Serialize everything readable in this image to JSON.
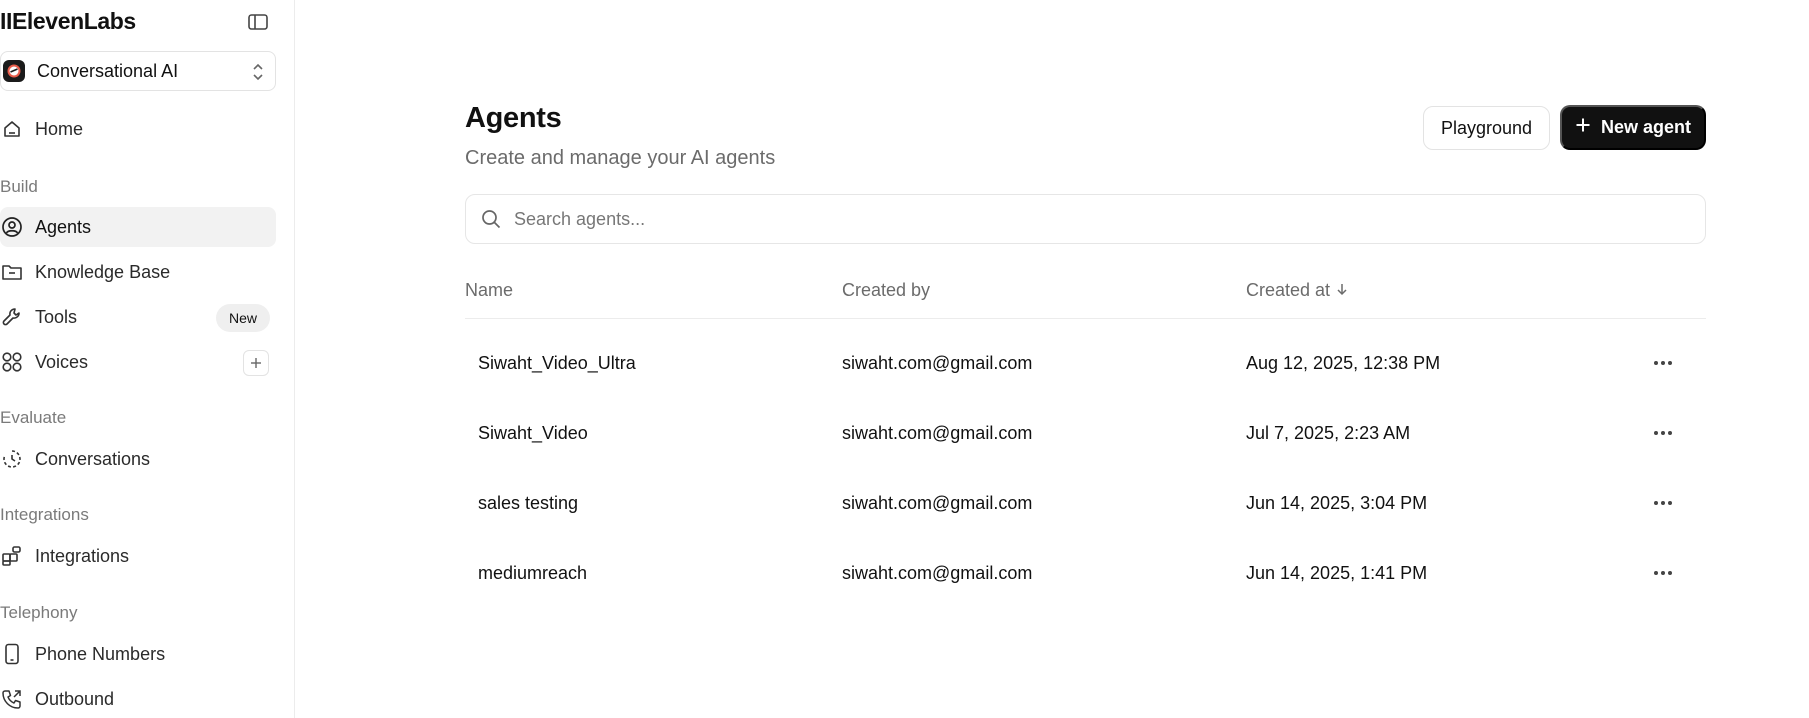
{
  "app": {
    "logo": "IIElevenLabs"
  },
  "workspace": {
    "label": "Conversational AI"
  },
  "sidebar": {
    "home": "Home",
    "sections": {
      "build": "Build",
      "evaluate": "Evaluate",
      "integrations": "Integrations",
      "telephony": "Telephony"
    },
    "items": {
      "agents": "Agents",
      "knowledge_base": "Knowledge Base",
      "tools": "Tools",
      "tools_badge": "New",
      "voices": "Voices",
      "conversations": "Conversations",
      "integrations": "Integrations",
      "phone_numbers": "Phone Numbers",
      "outbound": "Outbound"
    }
  },
  "header": {
    "title": "Agents",
    "subtitle": "Create and manage your AI agents",
    "playground_label": "Playground",
    "new_agent_label": "New agent"
  },
  "search": {
    "placeholder": "Search agents..."
  },
  "table": {
    "columns": {
      "name": "Name",
      "created_by": "Created by",
      "created_at": "Created at"
    },
    "rows": [
      {
        "name": "Siwaht_Video_Ultra",
        "created_by": "siwaht.com@gmail.com",
        "created_at": "Aug 12, 2025, 12:38 PM"
      },
      {
        "name": "Siwaht_Video",
        "created_by": "siwaht.com@gmail.com",
        "created_at": "Jul 7, 2025, 2:23 AM"
      },
      {
        "name": "sales testing",
        "created_by": "siwaht.com@gmail.com",
        "created_at": "Jun 14, 2025, 3:04 PM"
      },
      {
        "name": "mediumreach",
        "created_by": "siwaht.com@gmail.com",
        "created_at": "Jun 14, 2025, 1:41 PM"
      }
    ]
  },
  "icons": {
    "collapse": "sidebar-collapse-icon",
    "workspace": "workspace-logo-icon",
    "chevron": "chevron-up-down-icon",
    "home": "home-icon",
    "agents": "user-circle-icon",
    "knowledge_base": "archive-icon",
    "tools": "wrench-icon",
    "voices": "grid-circles-icon",
    "plus": "plus-icon",
    "conversations": "history-icon",
    "integrations": "blocks-icon",
    "phone_numbers": "phone-device-icon",
    "outbound": "phone-outgoing-icon",
    "search": "search-icon",
    "sort": "arrow-down-icon",
    "more": "more-horizontal-icon"
  },
  "colors": {
    "primary_button": "#111111",
    "active_nav": "#f2f2f2",
    "muted_text": "#6b6b6b"
  }
}
